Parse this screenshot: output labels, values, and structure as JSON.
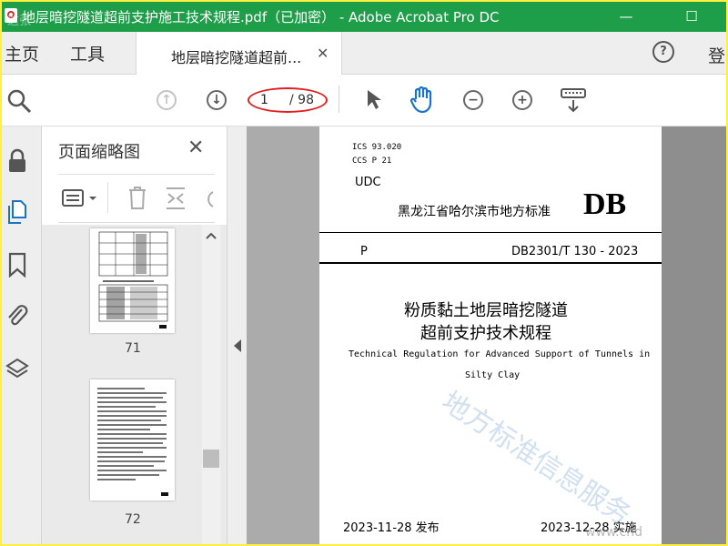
{
  "window": {
    "title": "地层暗挖隧道超前支护施工技术规程.pdf（已加密） - Adobe Acrobat Pro DC",
    "minimize": "—",
    "maximize": "☐",
    "close": "✕",
    "corner_watermark": "这张"
  },
  "menubar": {
    "home": "主页",
    "tools": "工具",
    "sign_in": "登录",
    "help": "?"
  },
  "tab": {
    "label": "地层暗挖隧道超前...",
    "close": "✕"
  },
  "toolbar": {
    "page_current": "1",
    "page_total": "/ 98"
  },
  "panel": {
    "title": "页面缩略图",
    "close": "✕",
    "thumbnails": [
      {
        "page_number": "71"
      },
      {
        "page_number": "72"
      }
    ]
  },
  "document": {
    "ics": "ICS 93.020",
    "ccs": "CCS P 21",
    "udc": "UDC",
    "issuer": "黑龙江省哈尔滨市地方标准",
    "db_mark": "DB",
    "p_letter": "P",
    "standard_number": "DB2301/T 130 - 2023",
    "title_line1": "粉质黏土地层暗挖隧道",
    "title_line2": "超前支护技术规程",
    "english_line1": "Technical Regulation for Advanced Support of Tunnels in",
    "english_line2": "Silty Clay",
    "issue_date": "2023-11-28 发布",
    "implement_date": "2023-12-28 实施",
    "watermark": "地方标准信息服务",
    "footer_watermark": "www.cnd"
  },
  "colors": {
    "titlebar": "#1F9E4A",
    "frame": "#FFEF3F",
    "active_icon": "#1A73C7",
    "annotation": "#E02020"
  }
}
